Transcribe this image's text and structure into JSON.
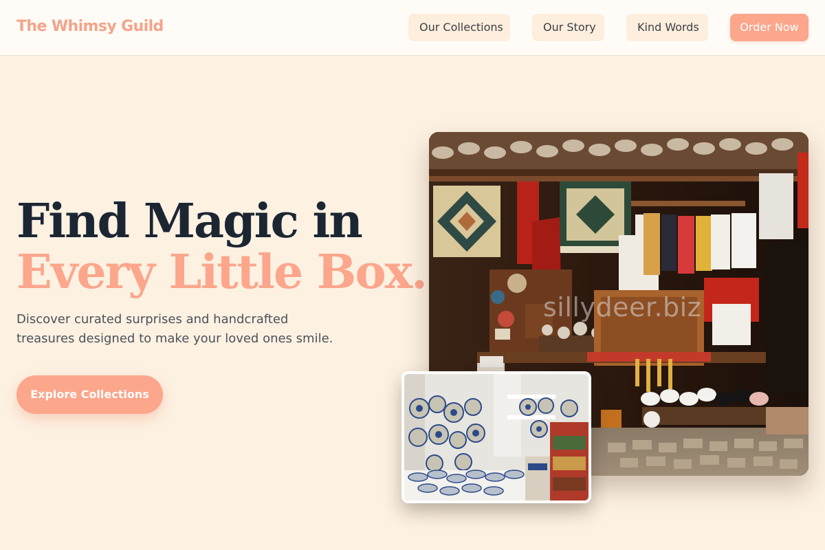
{
  "header": {
    "brand": "The Whimsy Guild",
    "nav": [
      {
        "label": "Our Collections"
      },
      {
        "label": "Our Story"
      },
      {
        "label": "Kind Words"
      }
    ],
    "order_label": "Order Now"
  },
  "hero": {
    "headline_line1": "Find Magic in",
    "headline_line2": "Every Little Box.",
    "subtitle": "Discover curated surprises and handcrafted treasures designed to make your loved ones smile.",
    "cta_label": "Explore Collections"
  },
  "images": {
    "main_watermark": "sillydeer.biz"
  },
  "colors": {
    "accent": "#fca68c",
    "background": "#fdf1e2",
    "header_bg": "#fffcf8",
    "nav_button_bg": "#fdeedd",
    "headline_dark": "#1c2633"
  }
}
